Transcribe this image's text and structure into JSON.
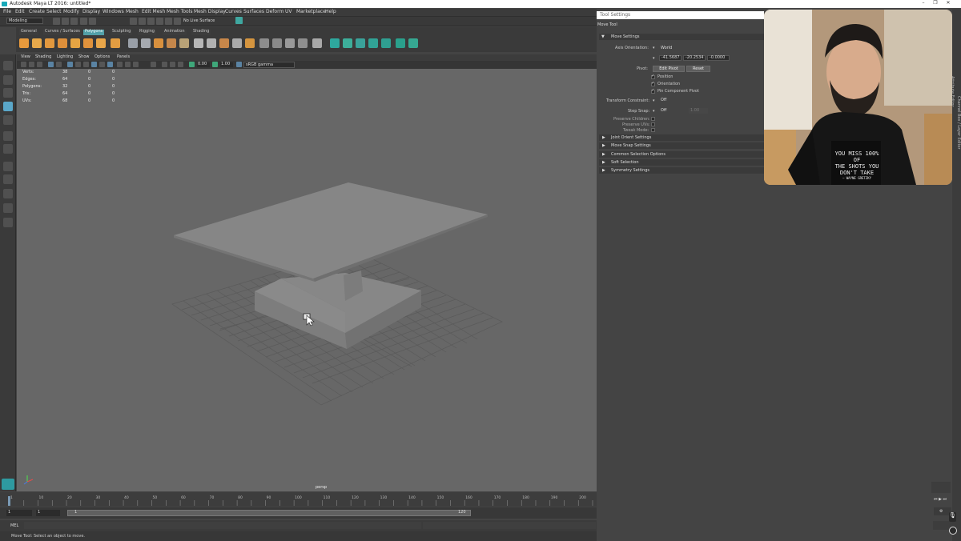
{
  "window": {
    "title": "Autodesk Maya LT 2016: untitled*",
    "min": "–",
    "max": "❐",
    "close": "✕"
  },
  "menubar": [
    "File",
    "Edit",
    "Create",
    "Select",
    "Modify",
    "Display",
    "Windows",
    "Mesh",
    "Edit Mesh",
    "Mesh Tools",
    "Mesh Display",
    "Curves",
    "Surfaces",
    "Deform",
    "UV",
    "Marketplace",
    "Help"
  ],
  "status": {
    "mode": "Modeling",
    "live_surface": "No Live Surface"
  },
  "shelf": {
    "tabs": [
      "General",
      "Curves / Surfaces",
      "Polygons",
      "Sculpting",
      "Rigging",
      "Animation",
      "Shading"
    ],
    "active": "Polygons"
  },
  "panel": {
    "menus": [
      "View",
      "Shading",
      "Lighting",
      "Show",
      "Options",
      "Panels"
    ],
    "near": "0.00",
    "far": "1.00",
    "colorspace": "sRGB gamma",
    "camera": "persp"
  },
  "hud": [
    {
      "label": "Verts:",
      "a": "38",
      "b": "0",
      "c": "0"
    },
    {
      "label": "Edges:",
      "a": "64",
      "b": "0",
      "c": "0"
    },
    {
      "label": "Polygons:",
      "a": "32",
      "b": "0",
      "c": "0"
    },
    {
      "label": "Tris:",
      "a": "64",
      "b": "0",
      "c": "0"
    },
    {
      "label": "UVs:",
      "a": "68",
      "b": "0",
      "c": "0"
    }
  ],
  "timeline": {
    "ticks": [
      "1",
      "5",
      "10",
      "15",
      "20",
      "25",
      "30",
      "35",
      "40",
      "45",
      "50",
      "55",
      "60",
      "65",
      "70",
      "75",
      "80",
      "85",
      "90",
      "95",
      "100",
      "105",
      "110",
      "115",
      "120",
      "125",
      "130",
      "135",
      "140",
      "145",
      "150",
      "155",
      "160",
      "165",
      "170",
      "175",
      "180",
      "185",
      "190",
      "195",
      "200",
      "205"
    ],
    "start": "1",
    "range_start": "1",
    "range_end": "120",
    "current": "1"
  },
  "cmdline": {
    "label": "MEL"
  },
  "helpline": "Move Tool: Select an object to move.",
  "tool_settings": {
    "header": "Tool Settings",
    "tool": "Move Tool",
    "move_settings": "Move Settings",
    "axis_orientation_label": "Axis Orientation:",
    "axis_orientation": "World",
    "x": "-41.5687",
    "y": "-20.2534",
    "z": "-0.0000",
    "pivot_label": "Pivot:",
    "edit_pivot": "Edit Pivot",
    "reset": "Reset",
    "position": "Position",
    "orientation": "Orientation",
    "per_component_pivot": "Pin Component Pivot",
    "transform_constraint_label": "Transform Constraint:",
    "transform_constraint": "Off",
    "step_snap_label": "Step Snap:",
    "step_snap": "Off",
    "step_value": "1.00",
    "preserve_children": "Preserve Children:",
    "preserve_uvs": "Preserve UVs:",
    "tweak_mode": "Tweak Mode:",
    "sections": [
      "Joint Orient Settings",
      "Move Snap Settings",
      "Common Selection Options",
      "Soft Selection",
      "Symmetry Settings"
    ]
  },
  "webcam": {
    "shirt_text": [
      "YOU MISS 100% OF",
      "THE SHOTS YOU",
      "DON'T TAKE"
    ],
    "shirt_sign": "— WAYNE GRETZKY"
  },
  "right_strip": {
    "labels": [
      "Attribute Editor",
      "Channel Box / Layer Editor"
    ]
  }
}
